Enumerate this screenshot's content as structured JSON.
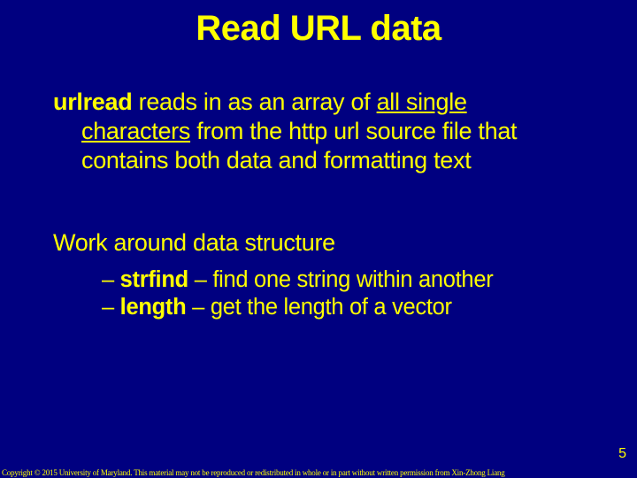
{
  "slide": {
    "title": "Read URL data",
    "para1_bold": "urlread",
    "para1_tail_a": " reads in as an array of ",
    "para1_underline": "all single characters",
    "para1_tail_b": " from the http url source file that contains both data and formatting text",
    "para2": "Work around data structure",
    "sub1_dash": "– ",
    "sub1_bold": "strfind",
    "sub1_tail": " – find one string within another",
    "sub2_dash": "– ",
    "sub2_bold": "length",
    "sub2_tail": " – get the length of a vector",
    "page_number": "5",
    "copyright": "Copyright © 2015 University of Maryland. This material may not be reproduced or redistributed in whole or in part without written permission from Xin-Zhong Liang"
  }
}
